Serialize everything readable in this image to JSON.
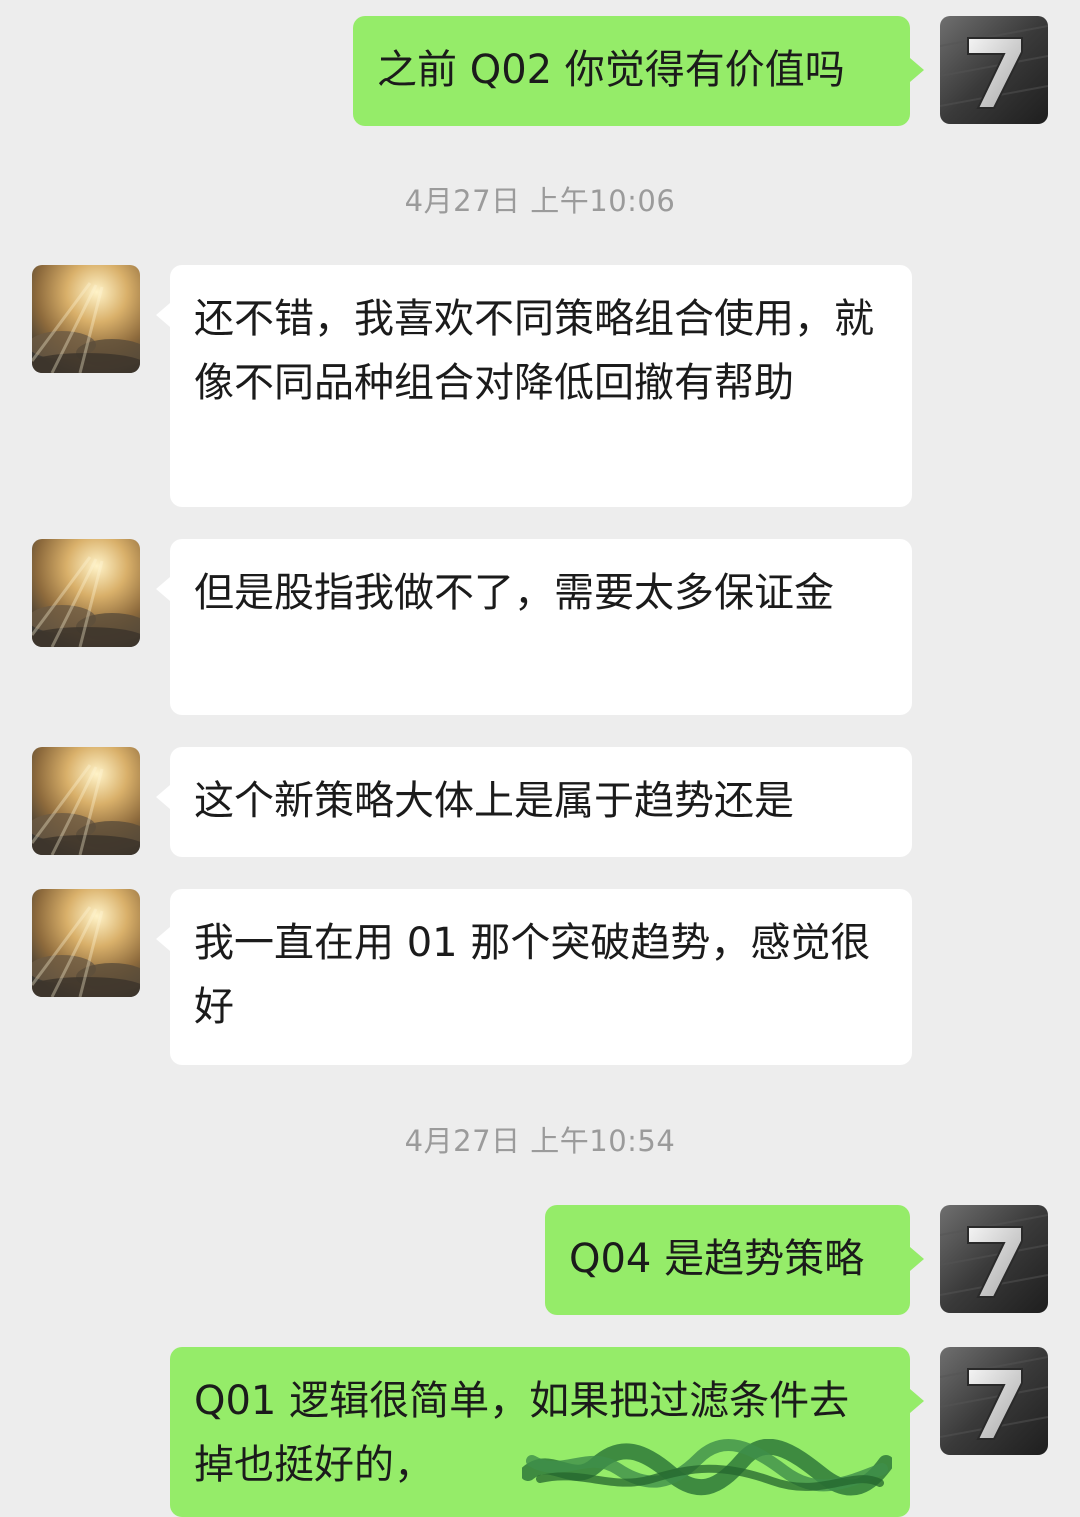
{
  "conversation": {
    "timestamps": [
      "4月27日 上午10:06",
      "4月27日 上午10:54"
    ],
    "messages": [
      {
        "sender": "self",
        "avatar": "number-7-avatar",
        "text": "之前 Q02 你觉得有价值吗"
      },
      {
        "sender": "contact",
        "avatar": "sunlit-clouds-avatar",
        "text": "还不错，我喜欢不同策略组合使用，就像不同品种组合对降低回撤有帮助"
      },
      {
        "sender": "contact",
        "avatar": "sunlit-clouds-avatar",
        "text": "但是股指我做不了，需要太多保证金"
      },
      {
        "sender": "contact",
        "avatar": "sunlit-clouds-avatar",
        "text": "这个新策略大体上是属于趋势还是"
      },
      {
        "sender": "contact",
        "avatar": "sunlit-clouds-avatar",
        "text": "我一直在用 01 那个突破趋势，感觉很好"
      },
      {
        "sender": "self",
        "avatar": "number-7-avatar",
        "text": "Q04 是趋势策略"
      },
      {
        "sender": "self",
        "avatar": "number-7-avatar",
        "text": "Q01 逻辑很简单，如果把过滤条件去掉也挺好的，"
      }
    ]
  },
  "colors": {
    "background": "#ededed",
    "self_bubble": "#95ec69",
    "contact_bubble": "#ffffff",
    "timestamp_text": "#9b9b9b",
    "redaction": "#2f7a3a"
  },
  "icons": {
    "self_avatar": "number-7-avatar",
    "contact_avatar": "sunlit-clouds-avatar",
    "redaction": "redaction-scribble"
  }
}
